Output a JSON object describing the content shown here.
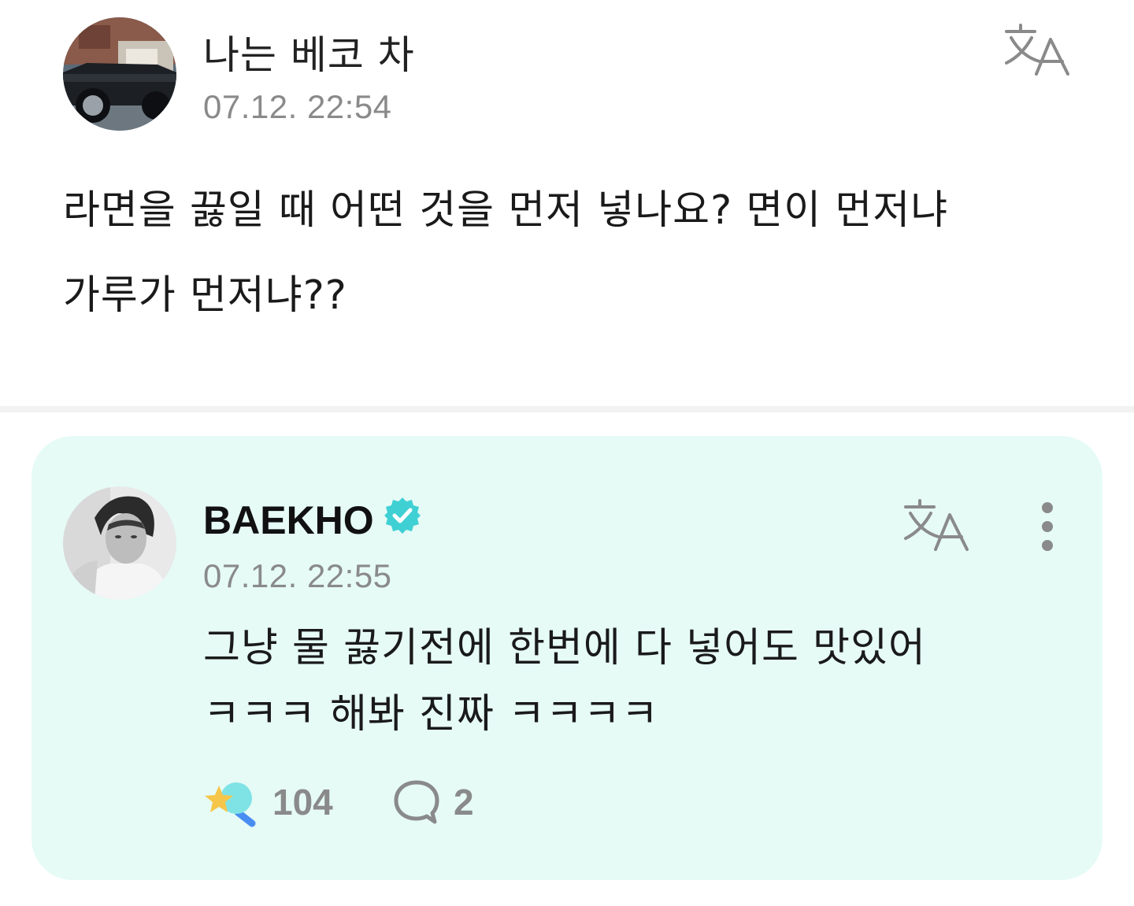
{
  "post": {
    "username": "나는 베코 차",
    "timestamp": "07.12. 22:54",
    "body_line1": "라면을 끓일 때 어떤 것을 먼저 넣나요? 면이 먼저냐",
    "body_line2": "가루가 먼저냐??",
    "avatar_icon": "car-photo-avatar",
    "translate_icon": "translate-icon"
  },
  "reply": {
    "username": "BAEKHO",
    "verified_icon": "verified-badge-icon",
    "timestamp": "07.12. 22:55",
    "body_line1": "그냥 물 끓기전에 한번에 다 넣어도 맛있어",
    "body_line2": "ㅋㅋㅋ 해봐 진짜 ㅋㅋㅋㅋ",
    "like_count": "104",
    "comment_count": "2",
    "like_icon": "star-wand-like-icon",
    "comment_icon": "speech-bubble-icon",
    "more_icon": "more-vertical-icon"
  },
  "colors": {
    "reply_bg": "#e6fbf6",
    "verified": "#3fd0d4",
    "muted_text": "#8a8a8a"
  }
}
